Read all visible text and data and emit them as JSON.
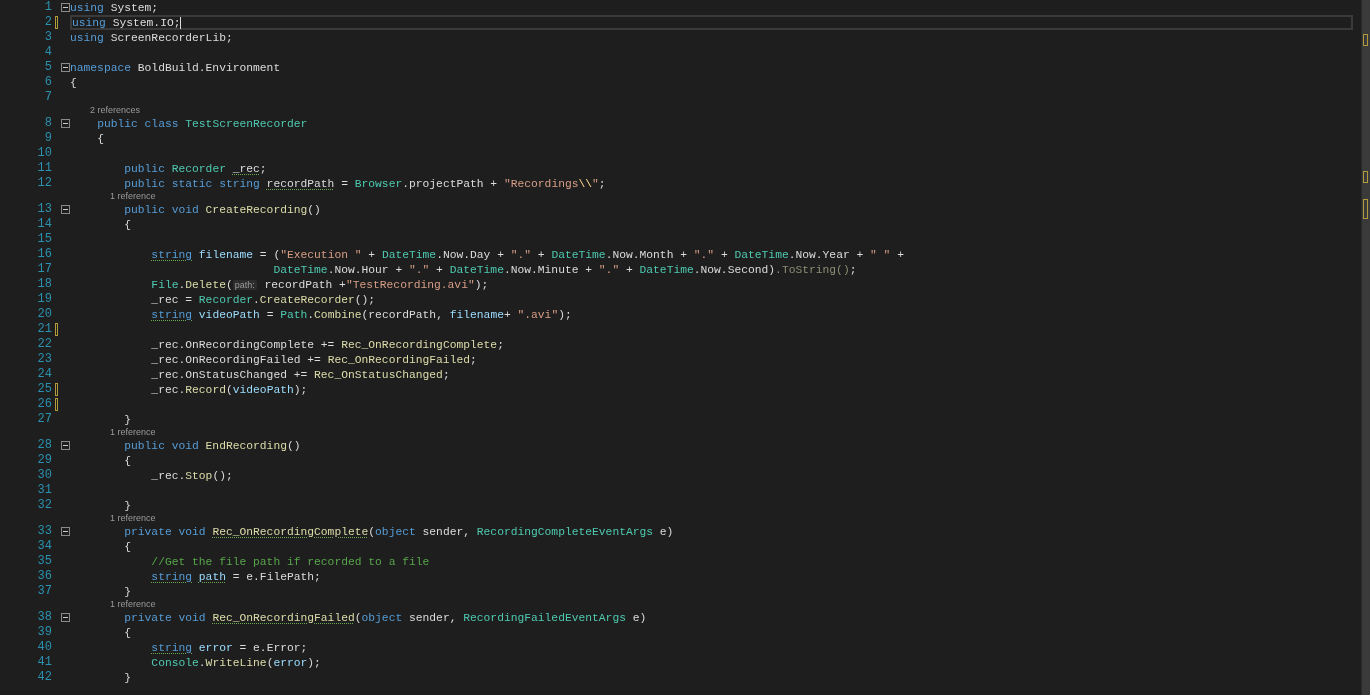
{
  "editor": {
    "lines": [
      {
        "number": "1",
        "foldable": true,
        "tokens": [
          {
            "kind": "kw",
            "text": "using"
          },
          {
            "kind": "plain",
            "text": " System;"
          }
        ]
      },
      {
        "number": "2",
        "current": true,
        "changed": true,
        "tokens": [
          {
            "kind": "kw",
            "text": "using"
          },
          {
            "kind": "plain",
            "text": " System.IO;"
          }
        ]
      },
      {
        "number": "3",
        "tokens": [
          {
            "kind": "kw",
            "text": "using"
          },
          {
            "kind": "plain",
            "text": " ScreenRecorderLib;"
          }
        ]
      },
      {
        "number": "4"
      },
      {
        "number": "5",
        "foldable": true,
        "tokens": [
          {
            "kind": "kw",
            "text": "namespace"
          },
          {
            "kind": "plain",
            "text": " BoldBuild.Environment"
          }
        ]
      },
      {
        "number": "6",
        "tokens": [
          {
            "kind": "plain",
            "text": "{"
          }
        ]
      },
      {
        "number": "7"
      },
      {
        "number": "8",
        "foldable": true,
        "lens": "2 references",
        "tokens": [
          {
            "kind": "kw",
            "text": "    public class"
          },
          {
            "kind": "type",
            "text": " TestScreenRecorder"
          }
        ]
      },
      {
        "number": "9",
        "tokens": [
          {
            "kind": "plain",
            "text": "    {"
          }
        ]
      },
      {
        "number": "10"
      },
      {
        "number": "11",
        "tokens": [
          {
            "kind": "kw",
            "text": "        public"
          },
          {
            "kind": "type",
            "text": " Recorder"
          },
          {
            "kind": "plain",
            "text": " _rec",
            "squiggle": true
          },
          {
            "kind": "plain",
            "text": ";"
          }
        ]
      },
      {
        "number": "12",
        "tokens": [
          {
            "kind": "kw",
            "text": "        public static string"
          },
          {
            "kind": "plain",
            "text": " recordPath",
            "squiggle": true
          },
          {
            "kind": "plain",
            "text": " = "
          },
          {
            "kind": "type",
            "text": "Browser"
          },
          {
            "kind": "plain",
            "text": ".projectPath + "
          },
          {
            "kind": "str",
            "text": "\"Recordings"
          },
          {
            "kind": "esc",
            "text": "\\\\"
          },
          {
            "kind": "str",
            "text": "\""
          },
          {
            "kind": "plain",
            "text": ";"
          }
        ]
      },
      {
        "number": "13",
        "foldable": true,
        "lens": "1 reference",
        "tokens": [
          {
            "kind": "kw",
            "text": "        public void"
          },
          {
            "kind": "method",
            "text": " CreateRecording"
          },
          {
            "kind": "plain",
            "text": "()"
          }
        ]
      },
      {
        "number": "14",
        "tokens": [
          {
            "kind": "plain",
            "text": "        {"
          }
        ]
      },
      {
        "number": "15"
      },
      {
        "number": "16",
        "tokens": [
          {
            "kind": "kw",
            "text": "            string",
            "squiggle": true
          },
          {
            "kind": "var",
            "text": " filename"
          },
          {
            "kind": "plain",
            "text": " = ("
          },
          {
            "kind": "str",
            "text": "\"Execution \""
          },
          {
            "kind": "plain",
            "text": " + "
          },
          {
            "kind": "type",
            "text": "DateTime"
          },
          {
            "kind": "plain",
            "text": ".Now.Day + "
          },
          {
            "kind": "str",
            "text": "\".\""
          },
          {
            "kind": "plain",
            "text": " + "
          },
          {
            "kind": "type",
            "text": "DateTime"
          },
          {
            "kind": "plain",
            "text": ".Now.Month + "
          },
          {
            "kind": "str",
            "text": "\".\""
          },
          {
            "kind": "plain",
            "text": " + "
          },
          {
            "kind": "type",
            "text": "DateTime"
          },
          {
            "kind": "plain",
            "text": ".Now.Year + "
          },
          {
            "kind": "str",
            "text": "\" \""
          },
          {
            "kind": "plain",
            "text": " +"
          }
        ]
      },
      {
        "number": "17",
        "tokens": [
          {
            "kind": "type",
            "text": "                              DateTime"
          },
          {
            "kind": "plain",
            "text": ".Now.Hour + "
          },
          {
            "kind": "str",
            "text": "\".\""
          },
          {
            "kind": "plain",
            "text": " + "
          },
          {
            "kind": "type",
            "text": "DateTime"
          },
          {
            "kind": "plain",
            "text": ".Now.Minute + "
          },
          {
            "kind": "str",
            "text": "\".\""
          },
          {
            "kind": "plain",
            "text": " + "
          },
          {
            "kind": "type",
            "text": "DateTime"
          },
          {
            "kind": "plain",
            "text": ".Now.Second)"
          },
          {
            "kind": "faded",
            "text": ".ToString()"
          },
          {
            "kind": "plain",
            "text": ";"
          }
        ]
      },
      {
        "number": "18",
        "tokens": [
          {
            "kind": "type",
            "text": "            File"
          },
          {
            "kind": "plain",
            "text": "."
          },
          {
            "kind": "method",
            "text": "Delete"
          },
          {
            "kind": "plain",
            "text": "("
          },
          {
            "kind": "hint",
            "text": "path:"
          },
          {
            "kind": "plain",
            "text": " recordPath +"
          },
          {
            "kind": "str",
            "text": "\"TestRecording.avi\""
          },
          {
            "kind": "plain",
            "text": ");"
          }
        ]
      },
      {
        "number": "19",
        "tokens": [
          {
            "kind": "plain",
            "text": "            _rec = "
          },
          {
            "kind": "type",
            "text": "Recorder"
          },
          {
            "kind": "plain",
            "text": "."
          },
          {
            "kind": "method",
            "text": "CreateRecorder"
          },
          {
            "kind": "plain",
            "text": "();"
          }
        ]
      },
      {
        "number": "20",
        "tokens": [
          {
            "kind": "kw",
            "text": "            string",
            "squiggle": true
          },
          {
            "kind": "var",
            "text": " videoPath"
          },
          {
            "kind": "plain",
            "text": " = "
          },
          {
            "kind": "type",
            "text": "Path"
          },
          {
            "kind": "plain",
            "text": "."
          },
          {
            "kind": "method",
            "text": "Combine"
          },
          {
            "kind": "plain",
            "text": "(recordPath, "
          },
          {
            "kind": "var",
            "text": "filename"
          },
          {
            "kind": "plain",
            "text": "+ "
          },
          {
            "kind": "str",
            "text": "\".avi\""
          },
          {
            "kind": "plain",
            "text": ");"
          }
        ]
      },
      {
        "number": "21",
        "changed": true
      },
      {
        "number": "22",
        "tokens": [
          {
            "kind": "plain",
            "text": "            _rec.OnRecordingComplete += "
          },
          {
            "kind": "method",
            "text": "Rec_OnRecordingComplete"
          },
          {
            "kind": "plain",
            "text": ";"
          }
        ]
      },
      {
        "number": "23",
        "tokens": [
          {
            "kind": "plain",
            "text": "            _rec.OnRecordingFailed += "
          },
          {
            "kind": "method",
            "text": "Rec_OnRecordingFailed"
          },
          {
            "kind": "plain",
            "text": ";"
          }
        ]
      },
      {
        "number": "24",
        "tokens": [
          {
            "kind": "plain",
            "text": "            _rec.OnStatusChanged += "
          },
          {
            "kind": "method",
            "text": "Rec_OnStatusChanged"
          },
          {
            "kind": "plain",
            "text": ";"
          }
        ]
      },
      {
        "number": "25",
        "changed": true,
        "tokens": [
          {
            "kind": "plain",
            "text": "            _rec."
          },
          {
            "kind": "method",
            "text": "Record"
          },
          {
            "kind": "plain",
            "text": "("
          },
          {
            "kind": "var",
            "text": "videoPath"
          },
          {
            "kind": "plain",
            "text": ");"
          }
        ]
      },
      {
        "number": "26",
        "changed": true
      },
      {
        "number": "27",
        "tokens": [
          {
            "kind": "plain",
            "text": "        }"
          }
        ]
      },
      {
        "number": "28",
        "foldable": true,
        "lens": "1 reference",
        "tokens": [
          {
            "kind": "kw",
            "text": "        public void"
          },
          {
            "kind": "method",
            "text": " EndRecording"
          },
          {
            "kind": "plain",
            "text": "()"
          }
        ]
      },
      {
        "number": "29",
        "tokens": [
          {
            "kind": "plain",
            "text": "        {"
          }
        ]
      },
      {
        "number": "30",
        "tokens": [
          {
            "kind": "plain",
            "text": "            _rec."
          },
          {
            "kind": "method",
            "text": "Stop"
          },
          {
            "kind": "plain",
            "text": "();"
          }
        ]
      },
      {
        "number": "31"
      },
      {
        "number": "32",
        "tokens": [
          {
            "kind": "plain",
            "text": "        }"
          }
        ]
      },
      {
        "number": "33",
        "foldable": true,
        "lens": "1 reference",
        "tokens": [
          {
            "kind": "kw",
            "text": "        private void"
          },
          {
            "kind": "method",
            "text": " Rec_OnRecordingComplete",
            "squiggle": true
          },
          {
            "kind": "plain",
            "text": "("
          },
          {
            "kind": "kw",
            "text": "object"
          },
          {
            "kind": "plain",
            "text": " sender, "
          },
          {
            "kind": "type",
            "text": "RecordingCompleteEventArgs"
          },
          {
            "kind": "plain",
            "text": " e)"
          }
        ]
      },
      {
        "number": "34",
        "tokens": [
          {
            "kind": "plain",
            "text": "        {"
          }
        ]
      },
      {
        "number": "35",
        "tokens": [
          {
            "kind": "comment",
            "text": "            //Get the file path if recorded to a file"
          }
        ]
      },
      {
        "number": "36",
        "tokens": [
          {
            "kind": "kw",
            "text": "            string",
            "squiggle": true
          },
          {
            "kind": "var",
            "text": " path",
            "squiggle": true
          },
          {
            "kind": "plain",
            "text": " = e.FilePath;"
          }
        ]
      },
      {
        "number": "37",
        "tokens": [
          {
            "kind": "plain",
            "text": "        }"
          }
        ]
      },
      {
        "number": "38",
        "foldable": true,
        "lens": "1 reference",
        "tokens": [
          {
            "kind": "kw",
            "text": "        private void"
          },
          {
            "kind": "method",
            "text": " Rec_OnRecordingFailed",
            "squiggle": true
          },
          {
            "kind": "plain",
            "text": "("
          },
          {
            "kind": "kw",
            "text": "object"
          },
          {
            "kind": "plain",
            "text": " sender, "
          },
          {
            "kind": "type",
            "text": "RecordingFailedEventArgs"
          },
          {
            "kind": "plain",
            "text": " e)"
          }
        ]
      },
      {
        "number": "39",
        "tokens": [
          {
            "kind": "plain",
            "text": "        {"
          }
        ]
      },
      {
        "number": "40",
        "tokens": [
          {
            "kind": "kw",
            "text": "            string",
            "squiggle": true
          },
          {
            "kind": "var",
            "text": " error"
          },
          {
            "kind": "plain",
            "text": " = e.Error;"
          }
        ]
      },
      {
        "number": "41",
        "tokens": [
          {
            "kind": "type",
            "text": "            Console"
          },
          {
            "kind": "plain",
            "text": "."
          },
          {
            "kind": "method",
            "text": "WriteLine"
          },
          {
            "kind": "plain",
            "text": "("
          },
          {
            "kind": "var",
            "text": "error"
          },
          {
            "kind": "plain",
            "text": ");"
          }
        ]
      },
      {
        "number": "42",
        "tokens": [
          {
            "kind": "plain",
            "text": "        }"
          }
        ]
      }
    ]
  }
}
